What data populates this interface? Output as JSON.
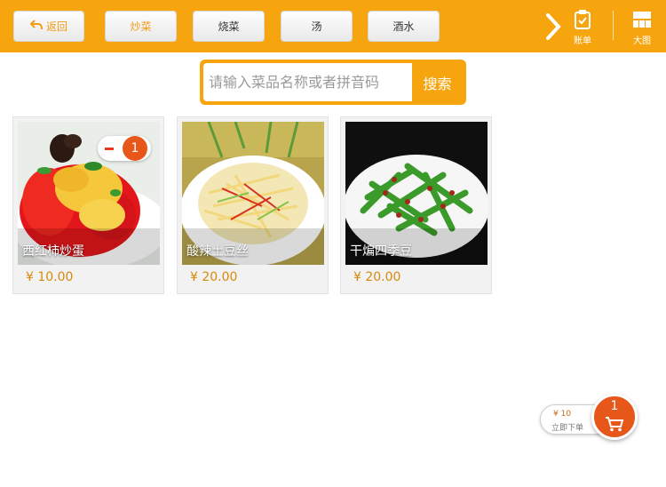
{
  "topbar": {
    "back_label": "返回",
    "categories": [
      {
        "label": "炒菜",
        "active": true
      },
      {
        "label": "烧菜",
        "active": false
      },
      {
        "label": "汤",
        "active": false
      },
      {
        "label": "酒水",
        "active": false
      }
    ],
    "bill_label": "账单",
    "big_view_label": "大图"
  },
  "search": {
    "placeholder": "请输入菜品名称或者拼音码",
    "button_label": "搜索"
  },
  "dishes": [
    {
      "name": "西红柿炒蛋",
      "price": "¥ 10.00",
      "count": "1"
    },
    {
      "name": "酸辣土豆丝",
      "price": "¥ 20.00"
    },
    {
      "name": "干煸四季豆",
      "price": "¥ 20.00"
    }
  ],
  "cart": {
    "total": "¥ 10",
    "order_label": "立即下单",
    "count": "1"
  },
  "colors": {
    "accent": "#f6a50f",
    "badge": "#e8571a",
    "price": "#d78a0c"
  }
}
